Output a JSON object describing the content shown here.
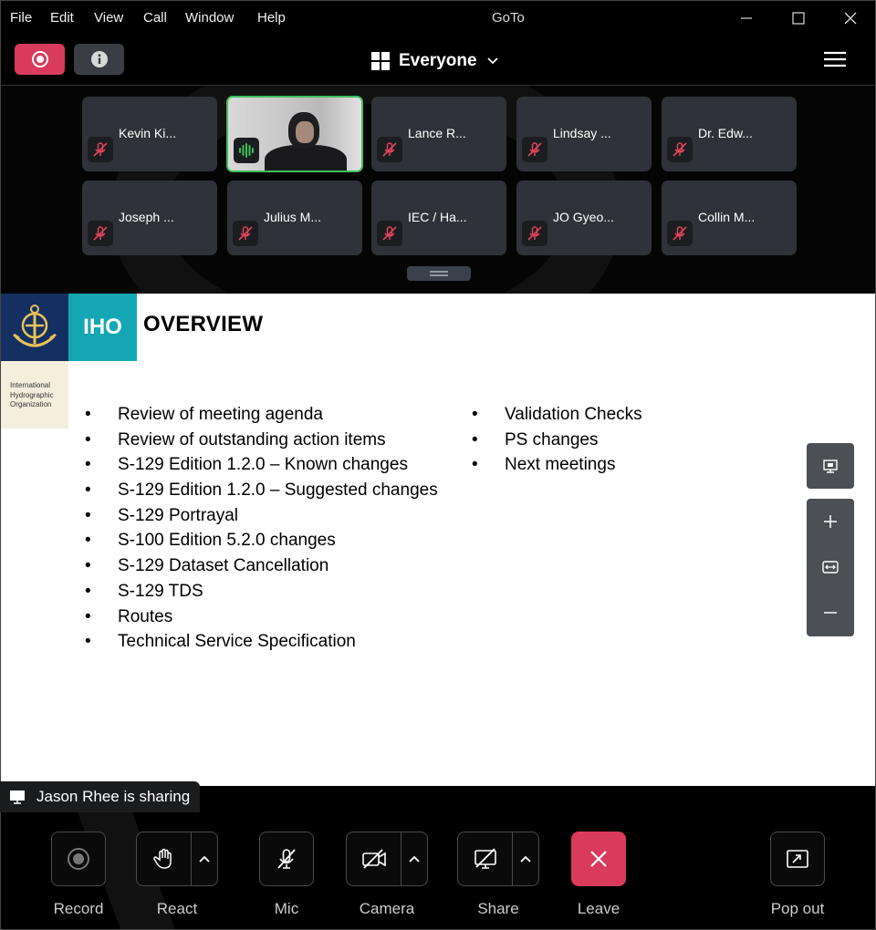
{
  "window": {
    "title": "GoTo",
    "menu": [
      "File",
      "Edit",
      "View",
      "Call",
      "Window",
      "Help"
    ]
  },
  "toolbar": {
    "view_label": "Everyone",
    "record_color": "#d93b5c"
  },
  "participants": [
    {
      "name": "Kevin Ki...",
      "muted": true
    },
    {
      "name": "",
      "muted": false,
      "video": true,
      "speaking": true
    },
    {
      "name": "Lance R...",
      "muted": true
    },
    {
      "name": "Lindsay ...",
      "muted": true
    },
    {
      "name": "Dr. Edw...",
      "muted": true
    },
    {
      "name": "Joseph ...",
      "muted": true
    },
    {
      "name": "Julius M...",
      "muted": true
    },
    {
      "name": "IEC / Ha...",
      "muted": true
    },
    {
      "name": "JO Gyeo...",
      "muted": true
    },
    {
      "name": "Collin M...",
      "muted": true
    }
  ],
  "slide": {
    "logo_text": "IHO",
    "org_line1": "International",
    "org_line2": "Hydrographic",
    "org_line3": "Organization",
    "title": "OVERVIEW",
    "bullet_char": "•",
    "left_items": [
      "Review of meeting agenda",
      "Review of outstanding action items",
      "S-129 Edition 1.2.0 – Known changes",
      "S-129 Edition 1.2.0 – Suggested changes",
      "S-129 Portrayal",
      "S-100 Edition 5.2.0 changes",
      "S-129 Dataset Cancellation",
      "S-129 TDS",
      "Routes",
      "Technical Service Specification"
    ],
    "right_items": [
      "Validation Checks",
      "PS changes",
      "Next meetings"
    ]
  },
  "sharing": {
    "text": "Jason Rhee is sharing"
  },
  "controls": {
    "record": "Record",
    "react": "React",
    "mic": "Mic",
    "camera": "Camera",
    "share": "Share",
    "leave": "Leave",
    "popout": "Pop out"
  },
  "colors": {
    "leave": "#d93b5c",
    "muted_icon": "#e0445f",
    "speaking": "#3fbf5a",
    "tile": "#2f3238"
  }
}
